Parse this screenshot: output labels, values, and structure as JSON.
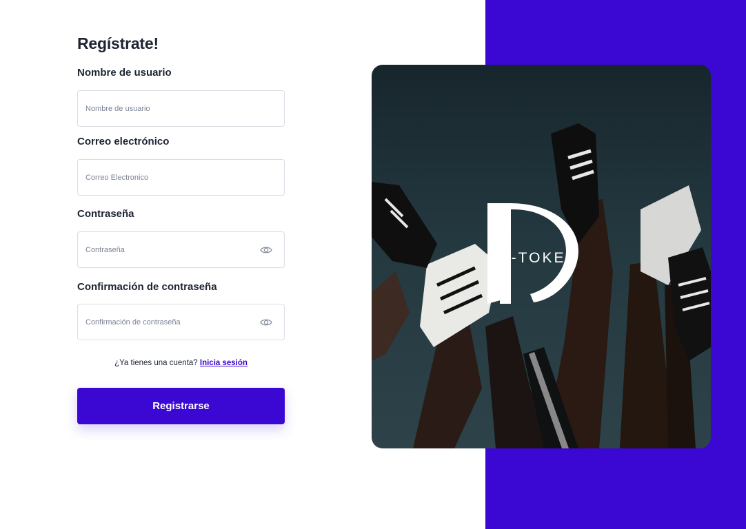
{
  "form": {
    "title": "Regístrate!",
    "username_label": "Nombre de usuario",
    "username_placeholder": "Nombre de usuario",
    "email_label": "Correo electrónico",
    "email_placeholder": "Correo Electronico",
    "password_label": "Contraseña",
    "password_placeholder": "Contraseña",
    "confirm_label": "Confirmación de contraseña",
    "confirm_placeholder": "Confirmación de contraseña",
    "account_prompt": "¿Ya tienes una cuenta?",
    "signin_link": "Inicia sesión",
    "submit_label": "Registrarse"
  },
  "brand": {
    "logo_text": "D-TOKE"
  },
  "icons": {
    "password_toggle": "eye-icon",
    "confirm_toggle": "eye-icon"
  },
  "colors": {
    "accent": "#3a07d3",
    "text": "#1d2433",
    "placeholder": "#7b8394",
    "border": "#d9dce3",
    "hero_bg": "#243840"
  }
}
